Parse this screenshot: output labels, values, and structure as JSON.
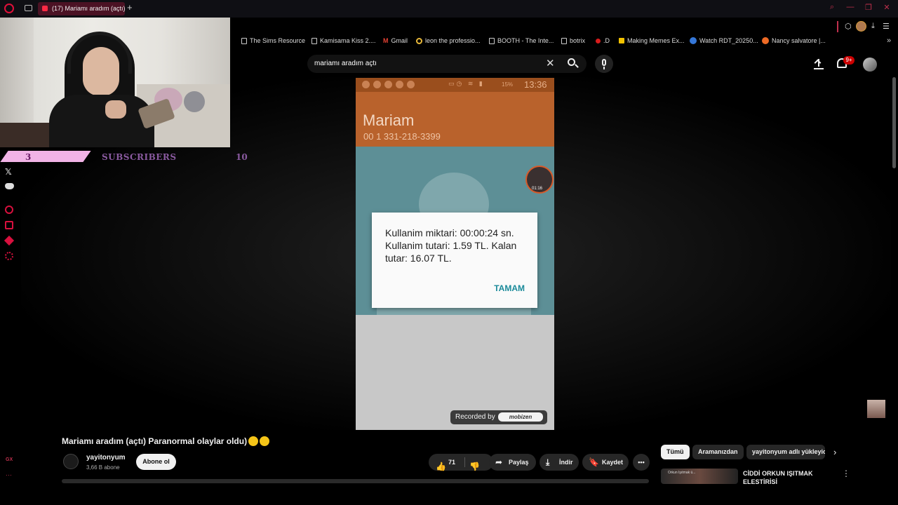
{
  "browser": {
    "tab_title": "(17) Mariamı aradım (açtı)",
    "new_tab": "+",
    "window_controls": [
      "⌕",
      "—",
      "❐",
      "✕"
    ],
    "bookmarks": [
      {
        "label": "The Sims Resource",
        "icon": "page-icon"
      },
      {
        "label": "Kamisama Kiss 2....",
        "icon": "page-icon"
      },
      {
        "label": "Gmail",
        "icon": "gmail-icon"
      },
      {
        "label": "leon the professio...",
        "icon": "google-icon"
      },
      {
        "label": "BOOTH - The Inte...",
        "icon": "page-icon"
      },
      {
        "label": "botrix",
        "icon": "page-icon"
      },
      {
        "label": ".D",
        "icon": "red-dot-icon"
      },
      {
        "label": "Making Memes Ex...",
        "icon": "z-icon"
      },
      {
        "label": "Watch RDT_20250...",
        "icon": "watch-icon"
      },
      {
        "label": "Nancy salvatore |...",
        "icon": "orange-icon"
      }
    ],
    "bookmarks_more": "»"
  },
  "youtube": {
    "search_query": "mariamı aradım açtı",
    "clear_symbol": "✕",
    "notification_count": "9+"
  },
  "overlay": {
    "sub_count_left": "3",
    "sub_label": "SUBSCRIBERS",
    "sub_count_right": "10",
    "x_icon": "𝕏"
  },
  "phone_video": {
    "clock": "13:36",
    "battery": "15%",
    "contact_name": "Mariam",
    "contact_number": "00 1 331-218-3399",
    "bubble_time": "01:16",
    "dialog_message": "Kullanim miktari: 00:00:24 sn. Kullanim tutari: 1.59 TL. Kalan tutar: 16.07 TL.",
    "dialog_ok": "TAMAM",
    "recorded_by": "Recorded by",
    "recorder_logo": "mobizen"
  },
  "video": {
    "title": "Mariamı aradım (açtı) Paranormal olaylar oldu)",
    "channel_name": "yayitonyum",
    "channel_subs": "3,66 B abone",
    "subscribe_label": "Abone ol",
    "like_count": "71",
    "share_label": "Paylaş",
    "download_label": "İndir",
    "save_label": "Kaydet",
    "more_label": "•••"
  },
  "recommendations": {
    "chips": [
      "Tümü",
      "Aramanızdan",
      "yayitonyum adlı yükleyici"
    ],
    "first_title": "CİDDİ ORKUN IŞITMAK ELEŞTİRİSİ",
    "first_thumb_text": "Orkun Işıtmak ü..."
  },
  "sidebar": {
    "gx_label": "GX",
    "dots": "···"
  }
}
